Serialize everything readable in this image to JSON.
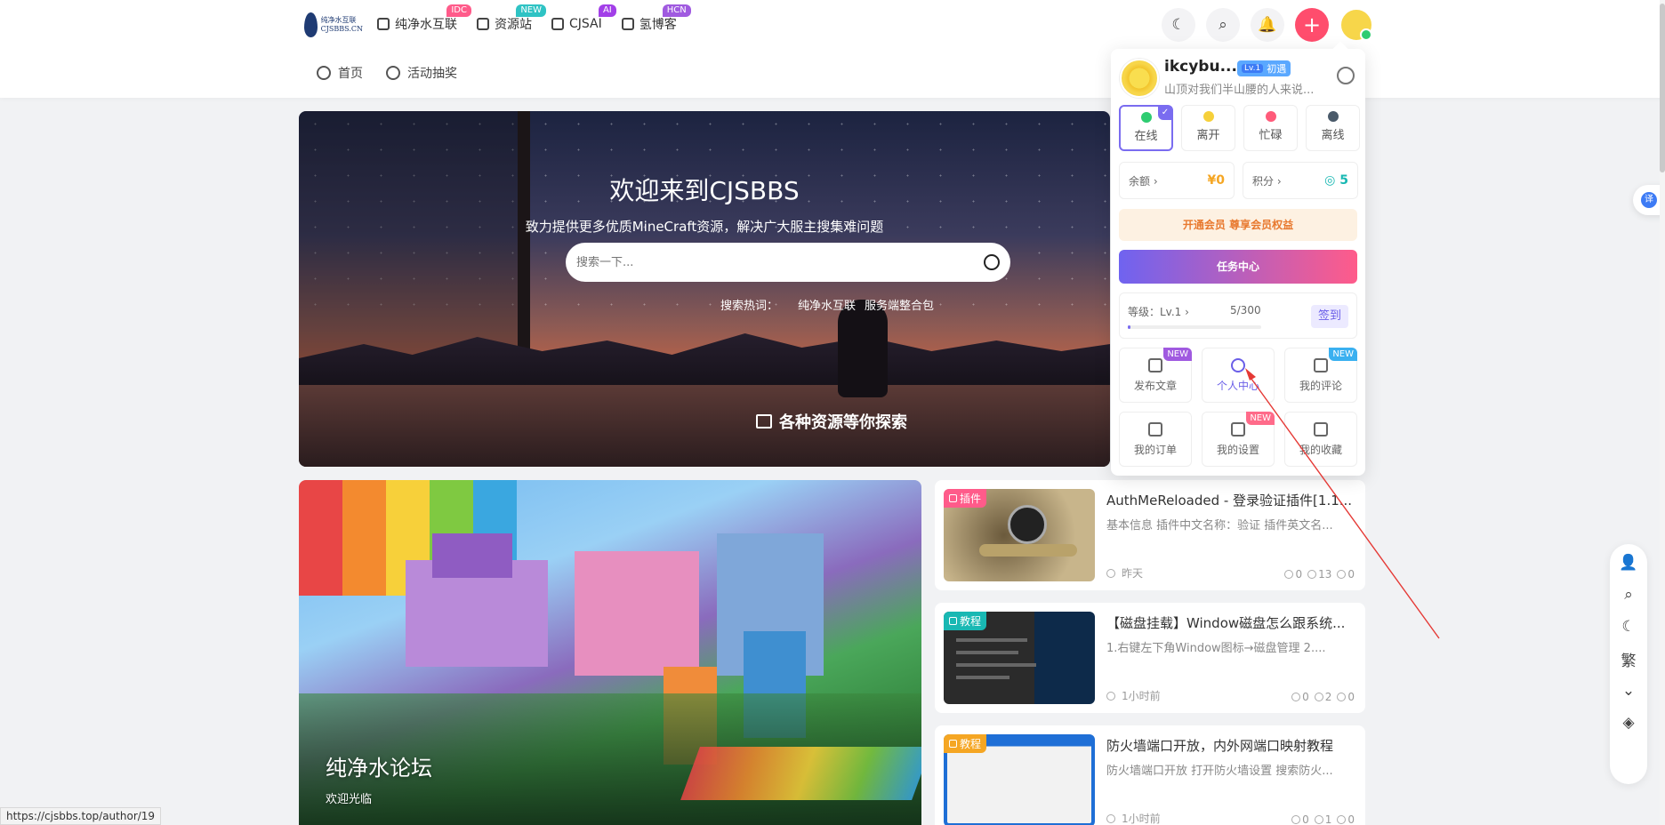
{
  "logo": {
    "text_line1": "纯净水互联",
    "text_line2": "CJSBBS.CN"
  },
  "topnav": [
    {
      "label": "纯净水互联",
      "badge": "IDC",
      "badge_color": "#ff5b8a"
    },
    {
      "label": "资源站",
      "badge": "NEW",
      "badge_color": "#2fc3c4"
    },
    {
      "label": "CJSAI",
      "badge": "AI",
      "badge_color": "#a23fe8"
    },
    {
      "label": "氢博客",
      "badge": "HCN",
      "badge_color": "#a05ae0"
    }
  ],
  "subnav": [
    {
      "label": "首页",
      "icon": "home-icon"
    },
    {
      "label": "活动抽奖",
      "icon": "gift-icon"
    }
  ],
  "header_buttons": [
    {
      "name": "dark-mode-icon",
      "glyph": "☾"
    },
    {
      "name": "search-icon",
      "glyph": "⌕"
    },
    {
      "name": "bell-icon",
      "glyph": "🔔"
    },
    {
      "name": "add-icon",
      "glyph": "+"
    }
  ],
  "banner": {
    "title": "欢迎来到CJSBBS",
    "subtitle": "致力提供更多优质MineCraft资源，解决广大服主搜集难问题",
    "search_placeholder": "搜索一下...",
    "hot_label": "搜索热词：",
    "hot_words": [
      "纯净水互联",
      "服务端整合包"
    ],
    "caption": "各种资源等你探索"
  },
  "feature": {
    "title": "纯净水论坛",
    "subtitle": "欢迎光临"
  },
  "posts": [
    {
      "tag": "插件",
      "tag_color": "#ff5b8a",
      "title": "AuthMeReloaded - 登录验证插件[1.1...",
      "desc": "基本信息 插件中文名称：验证 插件英文名...",
      "time": "昨天",
      "comments": "0",
      "views": "13",
      "likes": "0"
    },
    {
      "tag": "教程",
      "tag_color": "#19b8b3",
      "title": "【磁盘挂载】Window磁盘怎么跟系统...",
      "desc": "1.右键左下角Window图标→磁盘管理 2....",
      "time": "1小时前",
      "comments": "0",
      "views": "2",
      "likes": "0"
    },
    {
      "tag": "教程",
      "tag_color": "#f5a623",
      "title": "防火墙端口开放，内外网端口映射教程",
      "desc": "防火墙端口开放 打开防火墙设置 搜索防火...",
      "time": "1小时前",
      "comments": "0",
      "views": "1",
      "likes": "0"
    }
  ],
  "user_menu": {
    "name": "ikcybu...",
    "level_badge": "Lv.1",
    "level_title": "初遇",
    "signature": "山顶对我们半山腰的人来说...",
    "statuses": [
      {
        "label": "在线",
        "color": "#2ecc71"
      },
      {
        "label": "离开",
        "color": "#f6d03a"
      },
      {
        "label": "忙碌",
        "color": "#ff5b7a"
      },
      {
        "label": "离线",
        "color": "#4a5a6a"
      }
    ],
    "balance_label": "余额 ›",
    "balance_value": "¥0",
    "points_label": "积分 ›",
    "points_value": "◎ 5",
    "vip_label": "开通会员 尊享会员权益",
    "task_label": "任务中心",
    "level_label": "等级：Lv.1 ›",
    "level_progress": "5/300",
    "level_fraction": 0.0167,
    "signin_label": "签到",
    "tiles": [
      {
        "label": "发布文章",
        "badge": "NEW",
        "badge_color": "#a05ae0"
      },
      {
        "label": "个人中心",
        "badge": ""
      },
      {
        "label": "我的评论",
        "badge": "NEW",
        "badge_color": "#3ab0f0"
      },
      {
        "label": "我的订单",
        "badge": ""
      },
      {
        "label": "我的设置",
        "badge": "NEW",
        "badge_color": "#ff6b8a"
      },
      {
        "label": "我的收藏",
        "badge": ""
      }
    ]
  },
  "float_bar": [
    {
      "name": "user-icon",
      "glyph": "👤"
    },
    {
      "name": "search-icon",
      "glyph": "⌕"
    },
    {
      "name": "dark-mode-icon",
      "glyph": "☾"
    },
    {
      "name": "traditional-chinese-icon",
      "glyph": "繁"
    },
    {
      "name": "chevron-down-icon",
      "glyph": "⌄"
    },
    {
      "name": "theme-icon",
      "glyph": "◈"
    }
  ],
  "translate_label": "译",
  "status_url": "https://cjsbbs.top/author/19"
}
